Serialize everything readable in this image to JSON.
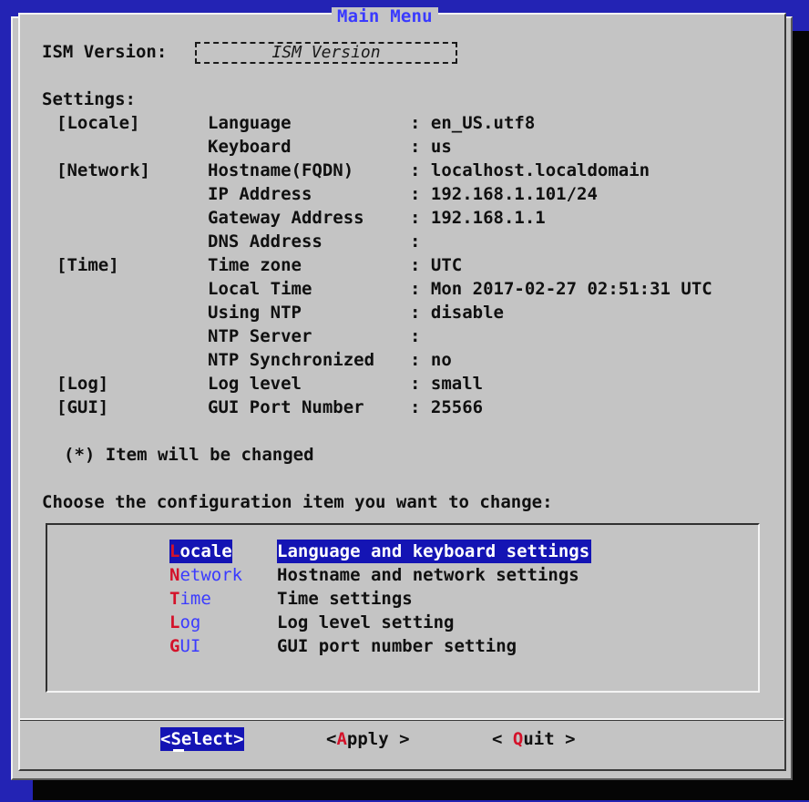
{
  "dialog": {
    "title": "Main Menu"
  },
  "version": {
    "label": "ISM Version:",
    "field_value": "ISM Version"
  },
  "settings": {
    "heading": "Settings:",
    "rows": [
      {
        "group": "[Locale]",
        "key": "Language",
        "value": ": en_US.utf8"
      },
      {
        "group": "",
        "key": "Keyboard",
        "value": ": us"
      },
      {
        "group": "[Network]",
        "key": "Hostname(FQDN)",
        "value": ": localhost.localdomain"
      },
      {
        "group": "",
        "key": "IP Address",
        "value": ": 192.168.1.101/24"
      },
      {
        "group": "",
        "key": "Gateway Address",
        "value": ": 192.168.1.1"
      },
      {
        "group": "",
        "key": "DNS Address",
        "value": ":"
      },
      {
        "group": "[Time]",
        "key": "Time zone",
        "value": ": UTC"
      },
      {
        "group": "",
        "key": "Local Time",
        "value": ": Mon 2017-02-27 02:51:31 UTC"
      },
      {
        "group": "",
        "key": "Using NTP",
        "value": ": disable"
      },
      {
        "group": "",
        "key": "NTP Server",
        "value": ":"
      },
      {
        "group": "",
        "key": "NTP Synchronized",
        "value": ": no"
      },
      {
        "group": "[Log]",
        "key": "Log level",
        "value": ": small"
      },
      {
        "group": "[GUI]",
        "key": "GUI Port Number",
        "value": ": 25566"
      }
    ]
  },
  "note": "(*) Item will be changed",
  "prompt": "Choose the configuration item you want to change:",
  "menu": [
    {
      "hot": "L",
      "rest": "ocale",
      "desc": "Language and keyboard settings"
    },
    {
      "hot": "N",
      "rest": "etwork",
      "desc": "Hostname and network settings"
    },
    {
      "hot": "T",
      "rest": "ime",
      "desc": "Time settings"
    },
    {
      "hot": "L",
      "rest": "og",
      "desc": "Log level setting"
    },
    {
      "hot": "G",
      "rest": "UI",
      "desc": "GUI port number setting"
    }
  ],
  "buttons": {
    "select": {
      "open": "<",
      "hot": "S",
      "rest": "elect>"
    },
    "apply": {
      "open": "<",
      "hot": "A",
      "rest": "pply >"
    },
    "quit": {
      "open": "< ",
      "hot": "Q",
      "rest": "uit >"
    }
  },
  "colors": {
    "background": "#2323b4",
    "dialog": "#c4c4c4",
    "highlight": "#1414b4",
    "hotkey": "#d4122a",
    "title": "#3a3aff"
  }
}
